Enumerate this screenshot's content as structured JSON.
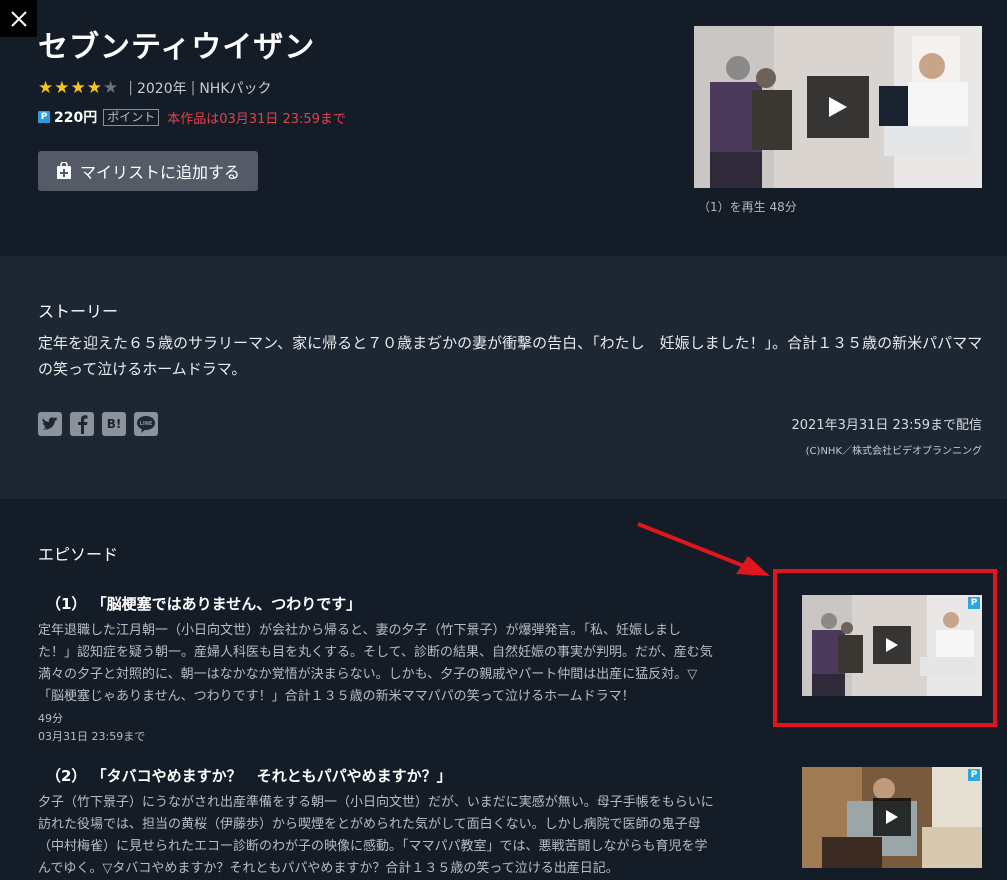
{
  "header": {
    "close_icon": "close-icon",
    "title": "セブンティウイザン",
    "rating": 4,
    "rating_max": 5,
    "year": "2020年",
    "pack": "NHKパック",
    "price": "220円",
    "point_label": "ポイント",
    "deadline": "本作品は03月31日 23:59まで",
    "mylist_label": "マイリストに追加する",
    "play_caption": "（1）を再生 48分"
  },
  "story": {
    "heading": "ストーリー",
    "text": "定年を迎えた６５歳のサラリーマン、家に帰ると７０歳まぢかの妻が衝撃の告白、「わたし　妊娠しました！」。合計１３５歳の新米パパママの笑って泣けるホームドラマ。",
    "share_icons": [
      "twitter-icon",
      "facebook-icon",
      "hatena-icon",
      "line-icon"
    ],
    "hatena_text": "B!",
    "line_text": "LINE",
    "availability": "2021年3月31日 23:59まで配信",
    "copyright": "(C)NHK／株式会社ビデオプランニング"
  },
  "episodes": {
    "heading": "エピソード",
    "items": [
      {
        "number": "（1）",
        "title": "「脳梗塞ではありません、つわりです」",
        "desc_lines": [
          "定年退職した江月朝一（小日向文世）が会社から帰ると、妻の夕子（竹下景子）が爆弾発言。「私、妊娠しまし",
          "た！」認知症を疑う朝一。産婦人科医も目を丸くする。そして、診断の結果、自然妊娠の事実が判明。だが、産む気",
          "満々の夕子と対照的に、朝一はなかなか覚悟が決まらない。しかも、夕子の親戚やパート仲間は出産に猛反対。▽",
          "「脳梗塞じゃありません、つわりです！」合計１３５歳の新米ママパパの笑って泣けるホームドラマ！"
        ],
        "duration": "49分",
        "until": "03月31日 23:59まで"
      },
      {
        "number": "（2）",
        "title": "「タバコやめますか？　それともパパやめますか？」",
        "desc_lines": [
          "夕子（竹下景子）にうながされ出産準備をする朝一（小日向文世）だが、いまだに実感が無い。母子手帳をもらいに",
          "訪れた役場では、担当の黄桜（伊藤歩）から喫煙をとがめられた気がして面白くない。しかし病院で医師の鬼子母",
          "（中村梅雀）に見せられたエコー診断のわが子の映像に感動。「ママパパ教室」では、悪戦苦闘しながらも育児を学",
          "んでゆく。▽タバコやめますか？それともパパやめますか？合計１３５歳の笑って泣ける出産日記。"
        ]
      }
    ]
  },
  "colors": {
    "background": "#141c27",
    "story_bg": "#1d2633",
    "accent_red": "#e0434b",
    "star": "#f5c518",
    "badge_blue": "#2a9de0"
  }
}
